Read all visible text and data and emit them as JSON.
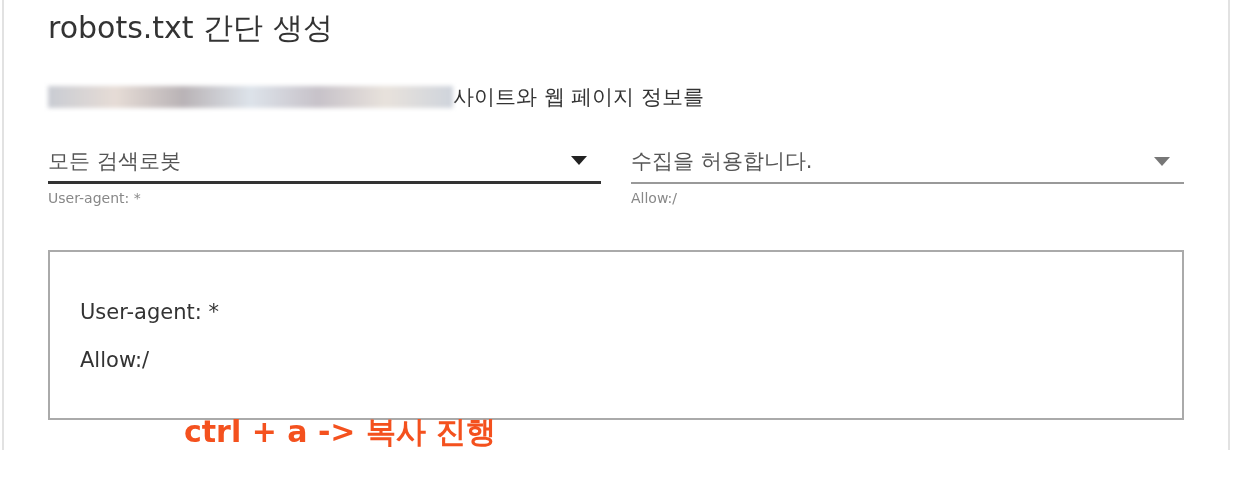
{
  "title": "robots.txt 간단 생성",
  "intro": "사이트와 웹 페이지 정보를",
  "selects": [
    {
      "value": "모든 검색로봇",
      "helper": "User-agent: *",
      "focused": true
    },
    {
      "value": "수집을 허용합니다.",
      "helper": "Allow:/",
      "focused": false
    }
  ],
  "output": {
    "lines": [
      "User-agent: *",
      "Allow:/"
    ]
  },
  "annotation": "ctrl + a -> 복사 진행"
}
